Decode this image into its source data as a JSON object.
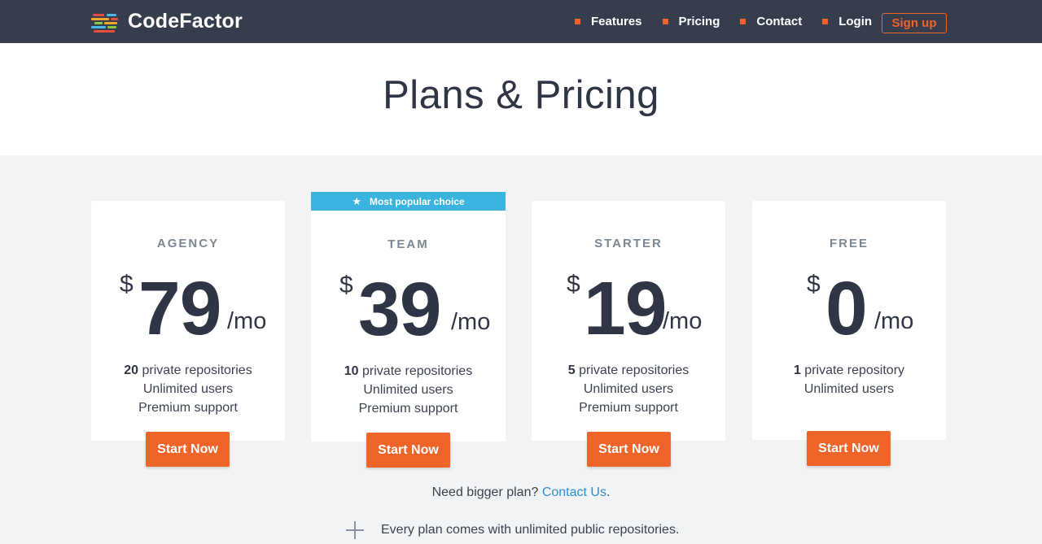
{
  "brand": {
    "name": "CodeFactor",
    "logo_colors": [
      "#e94e3c",
      "#f4a62a",
      "#4db6e6",
      "#8cc63f",
      "#e94e3c"
    ]
  },
  "nav": {
    "items": [
      {
        "label": "Features"
      },
      {
        "label": "Pricing"
      },
      {
        "label": "Contact"
      },
      {
        "label": "Login"
      }
    ],
    "signup_label": "Sign up"
  },
  "hero": {
    "title": "Plans & Pricing"
  },
  "badge": {
    "label": "Most popular choice",
    "icon": "star-icon"
  },
  "plans": [
    {
      "name": "AGENCY",
      "currency": "$",
      "amount": "79",
      "period": "/mo",
      "repo_count": "20",
      "repo_label": " private repositories",
      "users": "Unlimited users",
      "support": "Premium support",
      "cta": "Start Now"
    },
    {
      "name": "TEAM",
      "currency": "$",
      "amount": "39",
      "period": "/mo",
      "repo_count": "10",
      "repo_label": " private repositories",
      "users": "Unlimited users",
      "support": "Premium support",
      "cta": "Start Now"
    },
    {
      "name": "STARTER",
      "currency": "$",
      "amount": "19",
      "period": "/mo",
      "repo_count": "5",
      "repo_label": " private repositories",
      "users": "Unlimited users",
      "support": "Premium support",
      "cta": "Start Now"
    },
    {
      "name": "FREE",
      "currency": "$",
      "amount": "0",
      "period": "/mo",
      "repo_count": "1",
      "repo_label": " private repository",
      "users": "Unlimited users",
      "support": "",
      "cta": "Start Now"
    }
  ],
  "bigger": {
    "prefix": "Need bigger plan? ",
    "link": "Contact Us",
    "suffix": "."
  },
  "perk": {
    "text": "Every plan comes with unlimited public repositories.",
    "icon": "plus-icon"
  },
  "colors": {
    "accent": "#ef6429",
    "navbar": "#363d4c",
    "badge": "#3ab4de",
    "link": "#2a8fcb"
  }
}
